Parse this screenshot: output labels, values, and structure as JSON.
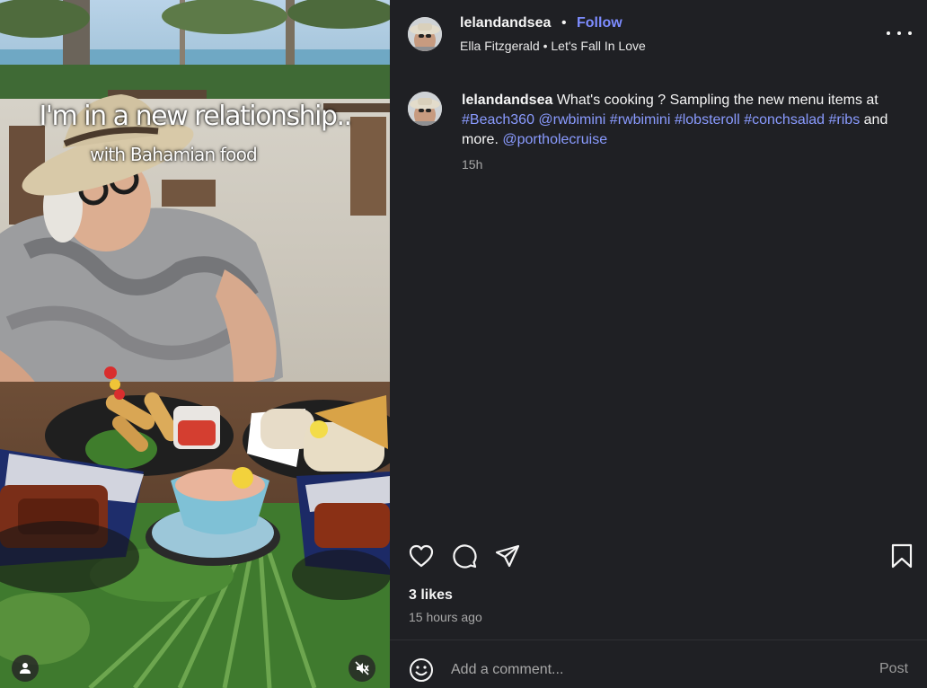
{
  "media": {
    "overlay_line1": "I'm in a new relationship..",
    "overlay_line2": "with Bahamian food",
    "tagged_users_icon": "person-icon",
    "mute_icon": "muted-speaker-icon"
  },
  "header": {
    "username": "lelandandsea",
    "separator": "•",
    "follow_label": "Follow",
    "music_text": "Ella Fitzgerald • Let's Fall In Love",
    "more_icon": "more-options-icon"
  },
  "caption": {
    "username": "lelandandsea",
    "text_before": "What's cooking ? Sampling the new menu items at",
    "tags": [
      "#Beach360",
      "@rwbimini",
      "#rwbimini",
      "#lobsteroll",
      "#conchsalad",
      "#ribs"
    ],
    "text_middle": "and more.",
    "mention": "@portholecruise",
    "time": "15h"
  },
  "actions": {
    "icons": [
      "heart-icon",
      "comment-icon",
      "share-icon",
      "bookmark-icon"
    ]
  },
  "stats": {
    "likes": "3 likes",
    "posted": "15 hours ago"
  },
  "comment": {
    "placeholder": "Add a comment...",
    "post_label": "Post"
  },
  "colors": {
    "background": "#1f2024",
    "link": "#8a9bff",
    "follow": "#7d8cff",
    "muted_text": "#a8a8a8"
  }
}
